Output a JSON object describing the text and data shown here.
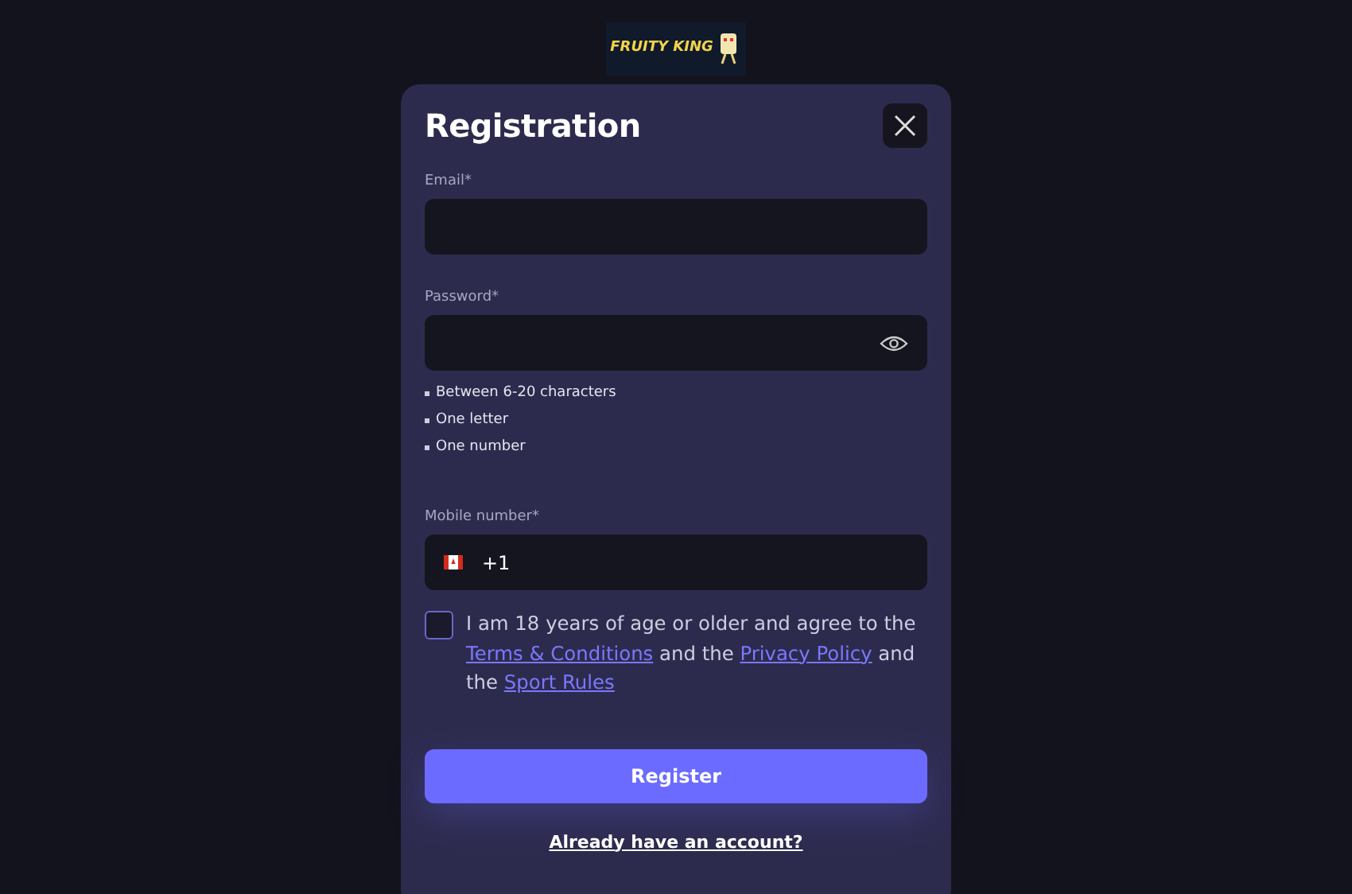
{
  "logo": {
    "text": "FRUITY KING"
  },
  "dialog": {
    "title": "Registration"
  },
  "fields": [
    {
      "kind": "email",
      "label": "Email*"
    },
    {
      "kind": "password",
      "label": "Password*",
      "rules": [
        "Between 6-20 characters",
        "One letter",
        "One number"
      ]
    },
    {
      "kind": "phone",
      "label": "Mobile number*",
      "value": "+1"
    }
  ],
  "agreement": {
    "checked": false,
    "parts": [
      {
        "kind": "text",
        "text": "I am 18 years of age or older and agree to the"
      },
      {
        "kind": "link",
        "text": "Terms & Conditions"
      },
      {
        "kind": "text",
        "text": "and the"
      },
      {
        "kind": "link",
        "text": "Privacy Policy"
      },
      {
        "kind": "text",
        "text": "and the"
      },
      {
        "kind": "link",
        "text": "Sport Rules"
      }
    ]
  },
  "submit": "Register",
  "login_link": "Already have an account?"
}
